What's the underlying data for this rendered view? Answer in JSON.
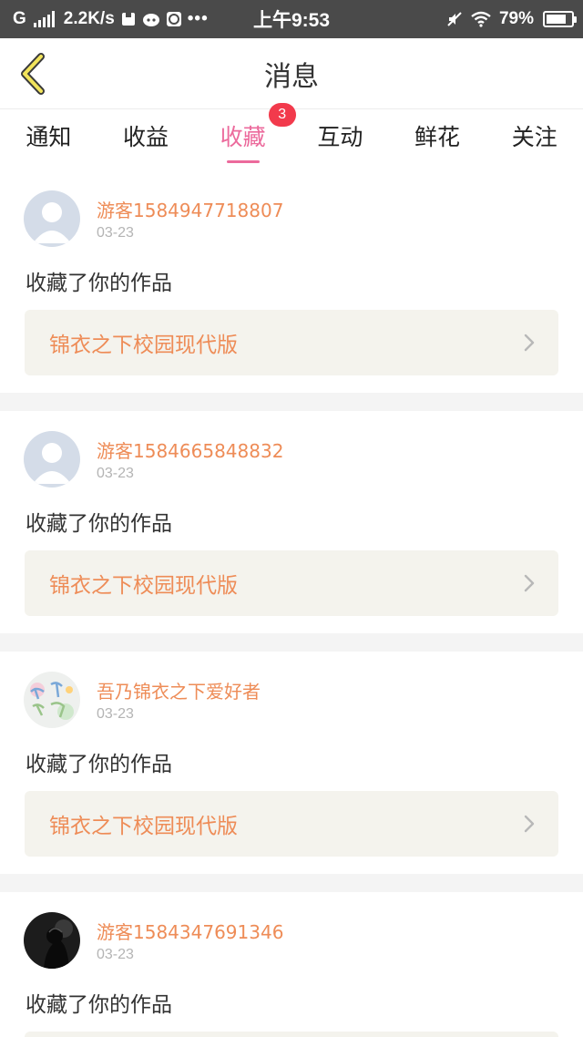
{
  "status_bar": {
    "network": "G",
    "speed": "2.2K/s",
    "time": "上午9:53",
    "battery": "79%",
    "battery_level": 0.79
  },
  "header": {
    "title": "消息"
  },
  "tabs": [
    {
      "label": "通知"
    },
    {
      "label": "收益"
    },
    {
      "label": "收藏",
      "badge": "3",
      "active": true
    },
    {
      "label": "互动"
    },
    {
      "label": "鲜花"
    },
    {
      "label": "关注"
    }
  ],
  "items": [
    {
      "user": "游客1584947718807",
      "date": "03-23",
      "action": "收藏了你的作品",
      "work": "锦衣之下校园现代版",
      "avatar": "default-avatar"
    },
    {
      "user": "游客1584665848832",
      "date": "03-23",
      "action": "收藏了你的作品",
      "work": "锦衣之下校园现代版",
      "avatar": "default-avatar"
    },
    {
      "user": "吾乃锦衣之下爱好者",
      "date": "03-23",
      "action": "收藏了你的作品",
      "work": "锦衣之下校园现代版",
      "avatar": "doodle-avatar"
    },
    {
      "user": "游客1584347691346",
      "date": "03-23",
      "action": "收藏了你的作品",
      "work": "",
      "avatar": "dark-silhouette-avatar"
    }
  ],
  "colors": {
    "accent_pink": "#ec6a9c",
    "name_orange": "#ee8c57",
    "badge_red": "#f23a4c",
    "status_bar": "#4a4a4a"
  }
}
